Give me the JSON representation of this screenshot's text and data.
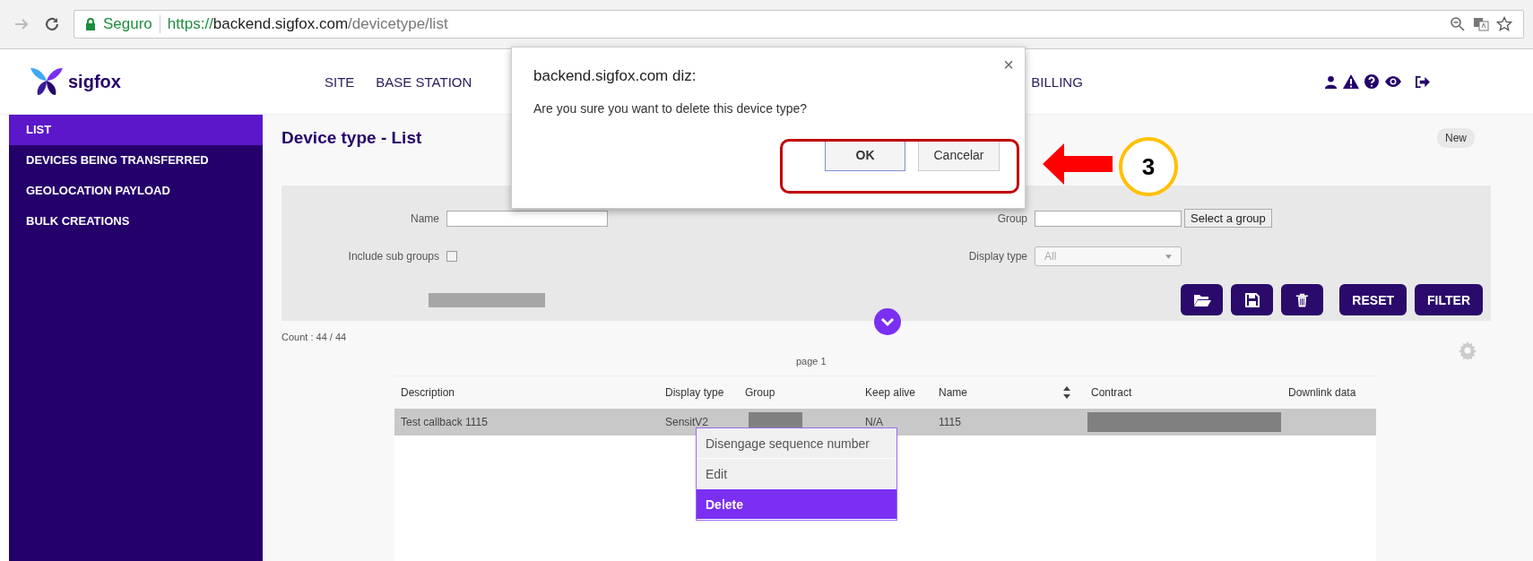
{
  "browser": {
    "security_label": "Seguro",
    "url": {
      "scheme": "https://",
      "host": "backend.sigfox.com",
      "path": "/devicetype/list"
    }
  },
  "header": {
    "logo_text": "sigfox",
    "nav": [
      {
        "label": "SITE"
      },
      {
        "label": "BASE STATION"
      },
      {
        "label": "BILLING"
      }
    ]
  },
  "sidebar": {
    "items": [
      {
        "label": "LIST",
        "selected": true
      },
      {
        "label": "DEVICES BEING TRANSFERRED",
        "selected": false
      },
      {
        "label": "GEOLOCATION PAYLOAD",
        "selected": false
      },
      {
        "label": "BULK CREATIONS",
        "selected": false
      }
    ]
  },
  "page": {
    "title": "Device type - List",
    "new_button": "New"
  },
  "filter": {
    "name_label": "Name",
    "group_label": "Group",
    "select_group_button": "Select a group",
    "include_sub_groups_label": "Include sub groups",
    "include_sub_groups_checked": false,
    "display_type_label": "Display type",
    "display_type_value": "All",
    "buttons": [
      {
        "kind": "folder"
      },
      {
        "kind": "save"
      },
      {
        "kind": "trash"
      },
      {
        "kind": "text",
        "label": "RESET"
      },
      {
        "kind": "text",
        "label": "FILTER"
      }
    ]
  },
  "count": "Count : 44 / 44",
  "pagination": "page 1",
  "table": {
    "columns": [
      {
        "label": "Description"
      },
      {
        "label": "Display type"
      },
      {
        "label": "Group"
      },
      {
        "label": "Keep alive"
      },
      {
        "label": "Name",
        "sortable": true
      },
      {
        "label": "Contract"
      },
      {
        "label": "Downlink data"
      }
    ],
    "rows": [
      {
        "selected": true,
        "cells": [
          {
            "kind": "text",
            "text": "Test callback 1115"
          },
          {
            "kind": "text",
            "text": "SensitV2"
          },
          {
            "kind": "redacted"
          },
          {
            "kind": "text",
            "text": "N/A"
          },
          {
            "kind": "text",
            "text": "1115"
          },
          {
            "kind": "redacted"
          },
          {
            "kind": "blank"
          }
        ]
      }
    ]
  },
  "context_menu": {
    "items": [
      {
        "label": "Disengage sequence number",
        "selected": false
      },
      {
        "label": "Edit",
        "selected": false
      },
      {
        "label": "Delete",
        "selected": true
      }
    ]
  },
  "dialog": {
    "title": "backend.sigfox.com diz:",
    "message": "Are you sure you want to delete this device type?",
    "close": "×",
    "buttons": [
      {
        "label": "OK",
        "focused": true
      },
      {
        "label": "Cancelar",
        "focused": false
      }
    ]
  },
  "annotation": {
    "step": "3"
  }
}
